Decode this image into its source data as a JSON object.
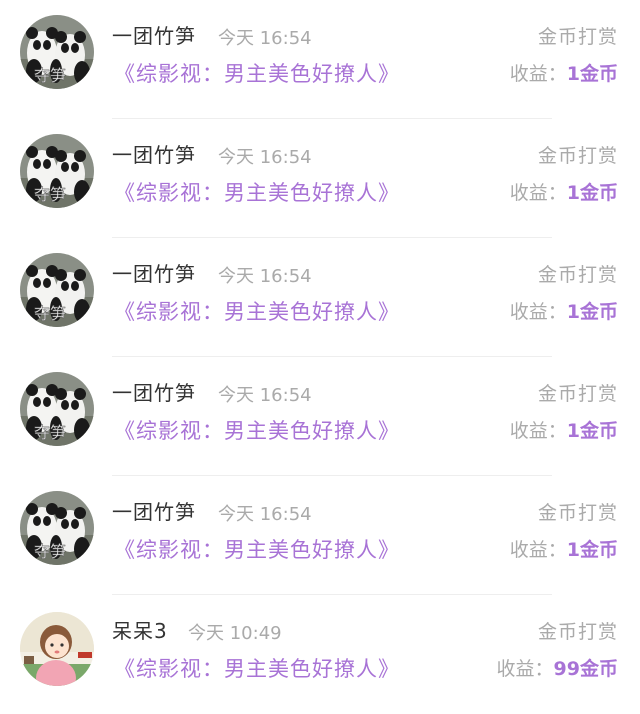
{
  "rows": [
    {
      "username": "一团竹笋",
      "time": "今天 16:54",
      "book": "《综影视：男主美色好撩人》",
      "type": "金币打赏",
      "income_label": "收益：",
      "income_value": "1金币",
      "avatar": "panda-avatar",
      "avatar_text": "夺笋"
    },
    {
      "username": "一团竹笋",
      "time": "今天 16:54",
      "book": "《综影视：男主美色好撩人》",
      "type": "金币打赏",
      "income_label": "收益：",
      "income_value": "1金币",
      "avatar": "panda-avatar",
      "avatar_text": "夺笋"
    },
    {
      "username": "一团竹笋",
      "time": "今天 16:54",
      "book": "《综影视：男主美色好撩人》",
      "type": "金币打赏",
      "income_label": "收益：",
      "income_value": "1金币",
      "avatar": "panda-avatar",
      "avatar_text": "夺笋"
    },
    {
      "username": "一团竹笋",
      "time": "今天 16:54",
      "book": "《综影视：男主美色好撩人》",
      "type": "金币打赏",
      "income_label": "收益：",
      "income_value": "1金币",
      "avatar": "panda-avatar",
      "avatar_text": "夺笋"
    },
    {
      "username": "一团竹笋",
      "time": "今天 16:54",
      "book": "《综影视：男主美色好撩人》",
      "type": "金币打赏",
      "income_label": "收益：",
      "income_value": "1金币",
      "avatar": "panda-avatar",
      "avatar_text": "夺笋"
    },
    {
      "username": "呆呆3",
      "time": "今天 10:49",
      "book": "《综影视：男主美色好撩人》",
      "type": "金币打赏",
      "income_label": "收益：",
      "income_value": "99金币",
      "avatar": "cartoon-girl-avatar"
    }
  ],
  "colors": {
    "accent": "#a873d6",
    "muted": "#aaaaaa",
    "text": "#333333"
  }
}
